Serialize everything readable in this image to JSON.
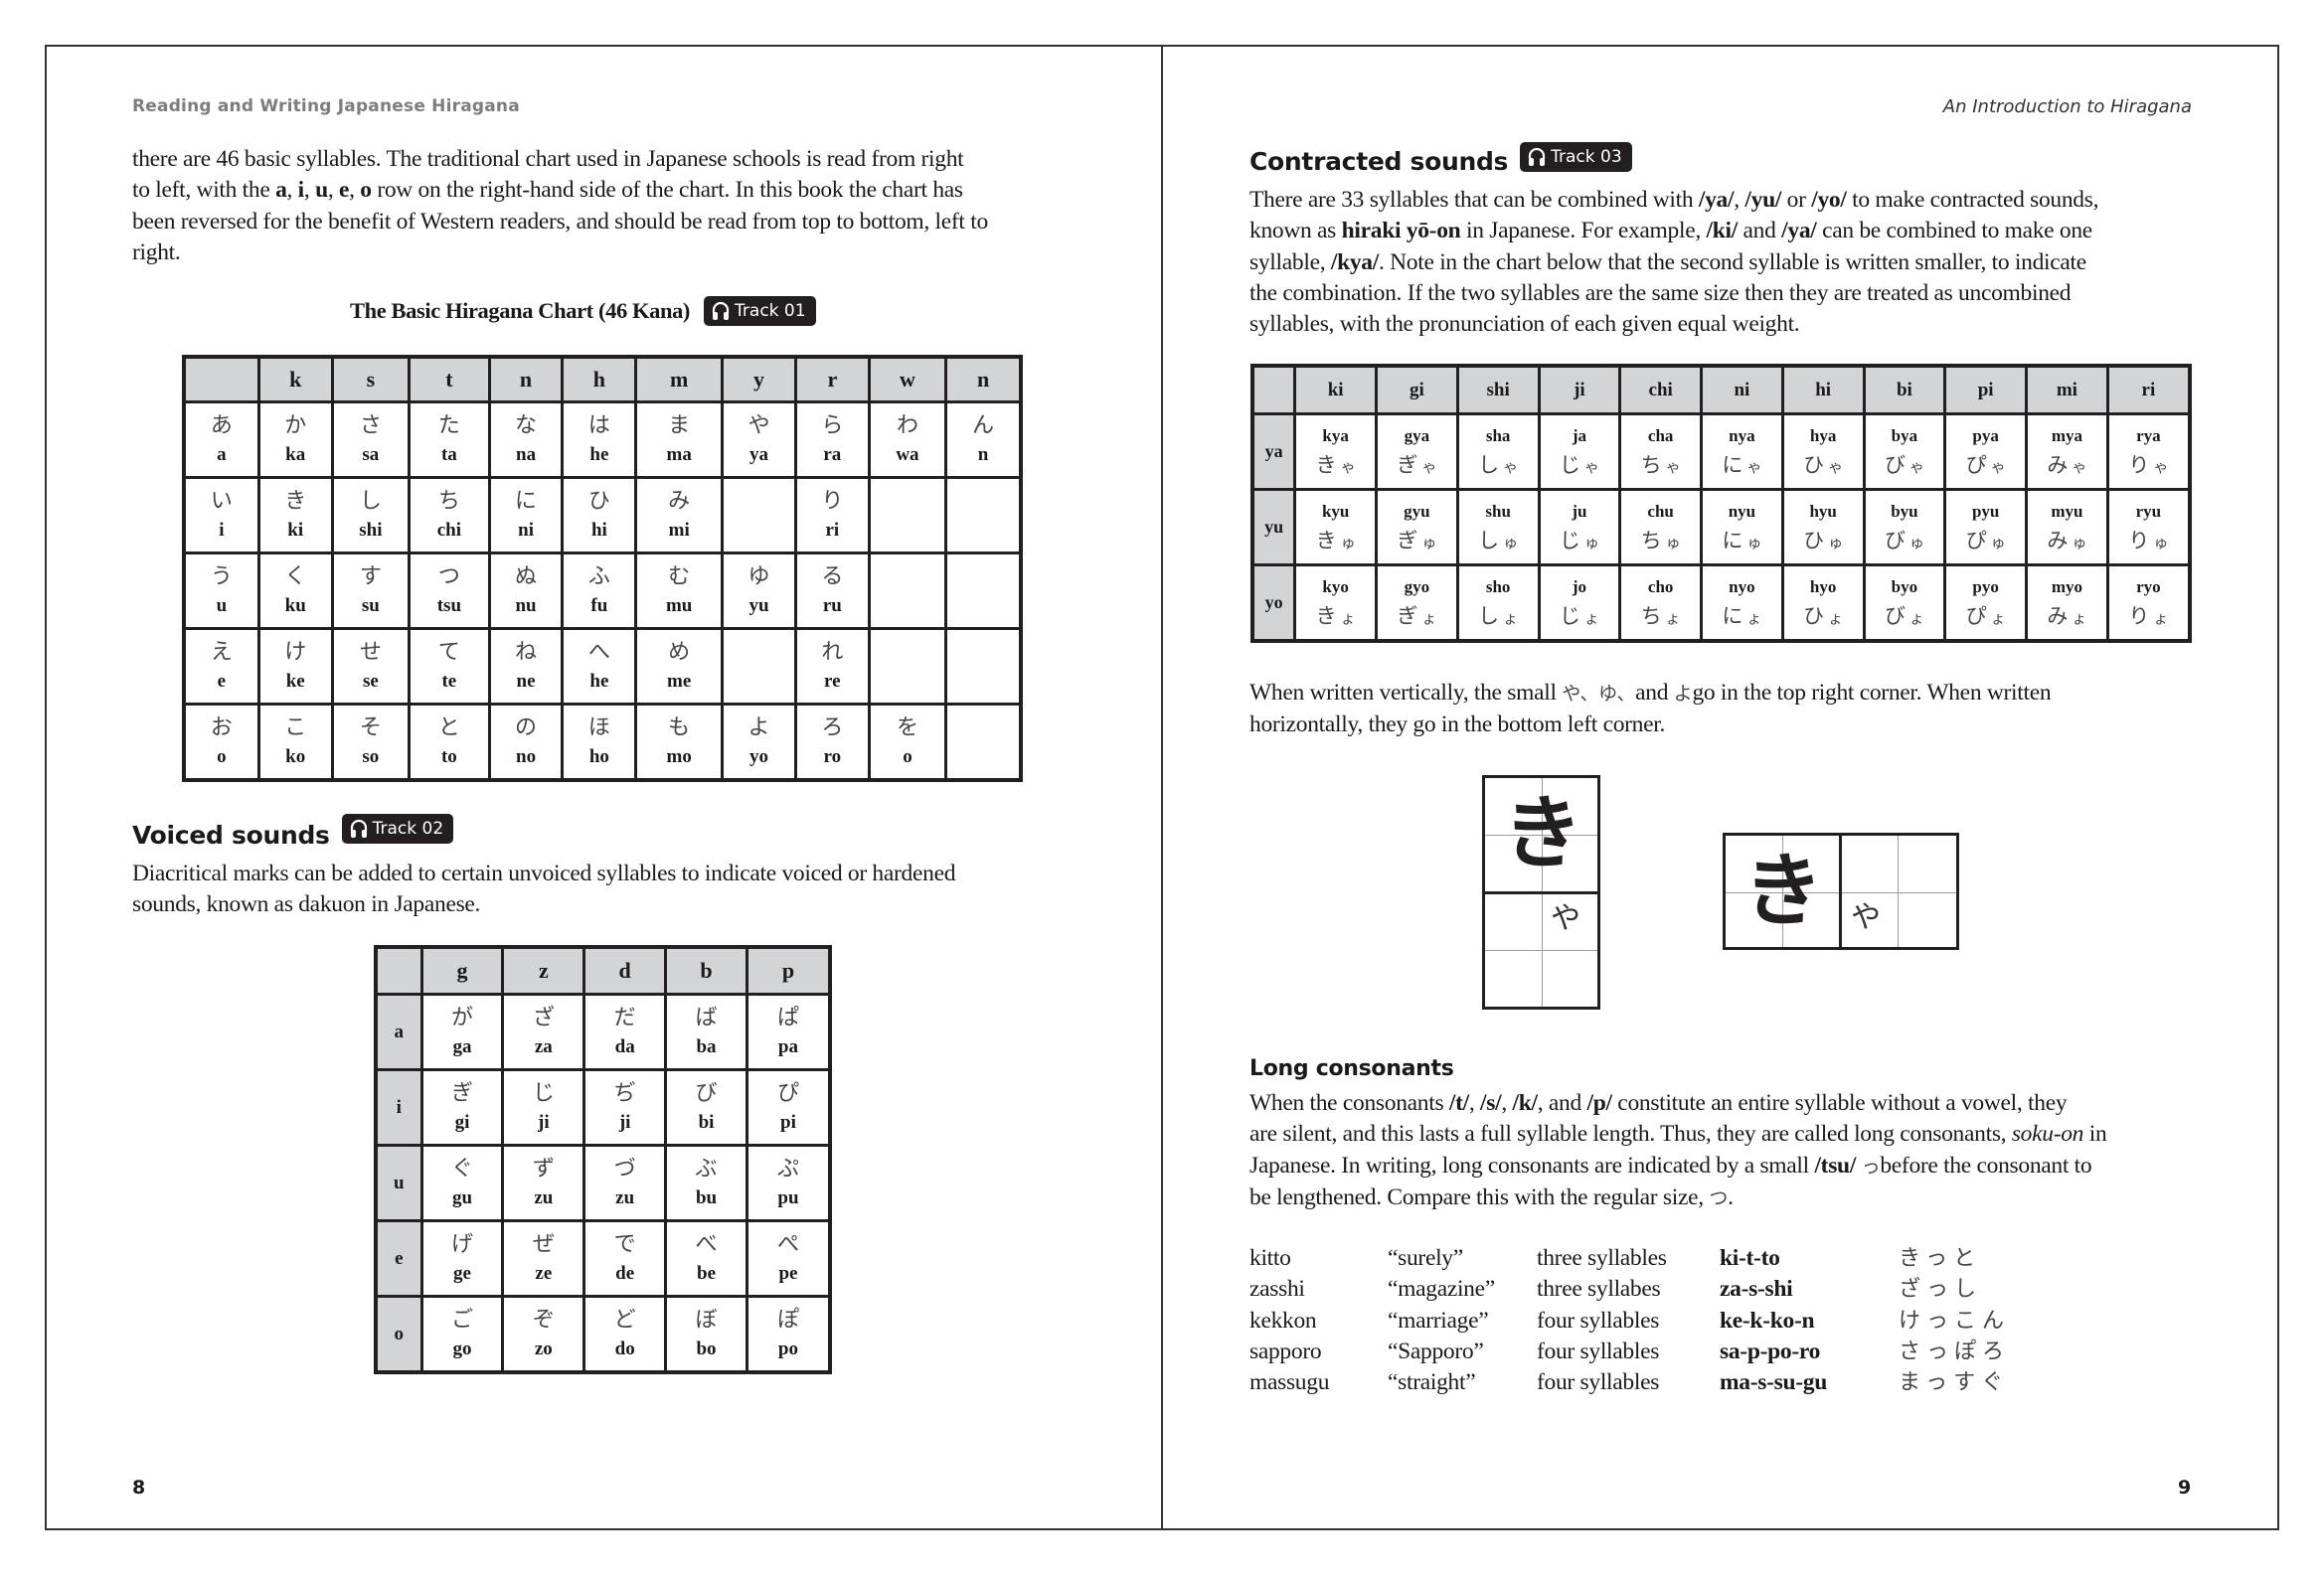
{
  "left_page": {
    "running_head": "Reading and Writing Japanese Hiragana",
    "intro_paragraph": [
      {
        "t": "there are 46 basic syllables. The traditional chart used in Japanese schools is read from right",
        "b": false
      },
      {
        "t": "to left, with the ",
        "b": false
      },
      {
        "t": "a",
        "b": true
      },
      {
        "t": ", ",
        "b": false
      },
      {
        "t": "i",
        "b": true
      },
      {
        "t": ", ",
        "b": false
      },
      {
        "t": "u",
        "b": true
      },
      {
        "t": ", ",
        "b": false
      },
      {
        "t": "e",
        "b": true
      },
      {
        "t": ", ",
        "b": false
      },
      {
        "t": "o",
        "b": true
      },
      {
        "t": " row on the right-hand side of the chart. In this book the chart has",
        "b": false
      },
      {
        "t": "been reversed for the benefit of Western readers, and should be read from top to bottom, left to",
        "b": false
      },
      {
        "t": "right.",
        "b": false
      }
    ],
    "intro_lines": [
      "there are 46 basic syllables. The traditional chart used in Japanese schools is read from right",
      "to left, with the |a|, |i|, |u|, |e|, |o| row on the right-hand side of the chart. In this book the chart has",
      "been reversed for the benefit of Western readers, and should be read from top to bottom, left to",
      "right."
    ],
    "basic_chart": {
      "title": "The Basic Hiragana Chart (46 Kana)",
      "track_label": "Track 01",
      "columns": [
        "",
        "k",
        "s",
        "t",
        "n",
        "h",
        "m",
        "y",
        "r",
        "w",
        "n"
      ],
      "rows": [
        [
          [
            "あ",
            "a"
          ],
          [
            "か",
            "ka"
          ],
          [
            "さ",
            "sa"
          ],
          [
            "た",
            "ta"
          ],
          [
            "な",
            "na"
          ],
          [
            "は",
            "he"
          ],
          [
            "ま",
            "ma"
          ],
          [
            "や",
            "ya"
          ],
          [
            "ら",
            "ra"
          ],
          [
            "わ",
            "wa"
          ],
          [
            "ん",
            "n"
          ]
        ],
        [
          [
            "い",
            "i"
          ],
          [
            "き",
            "ki"
          ],
          [
            "し",
            "shi"
          ],
          [
            "ち",
            "chi"
          ],
          [
            "に",
            "ni"
          ],
          [
            "ひ",
            "hi"
          ],
          [
            "み",
            "mi"
          ],
          [
            "",
            ""
          ],
          [
            "り",
            "ri"
          ],
          [
            "",
            ""
          ],
          [
            "",
            ""
          ]
        ],
        [
          [
            "う",
            "u"
          ],
          [
            "く",
            "ku"
          ],
          [
            "す",
            "su"
          ],
          [
            "つ",
            "tsu"
          ],
          [
            "ぬ",
            "nu"
          ],
          [
            "ふ",
            "fu"
          ],
          [
            "む",
            "mu"
          ],
          [
            "ゆ",
            "yu"
          ],
          [
            "る",
            "ru"
          ],
          [
            "",
            ""
          ],
          [
            "",
            ""
          ]
        ],
        [
          [
            "え",
            "e"
          ],
          [
            "け",
            "ke"
          ],
          [
            "せ",
            "se"
          ],
          [
            "て",
            "te"
          ],
          [
            "ね",
            "ne"
          ],
          [
            "へ",
            "he"
          ],
          [
            "め",
            "me"
          ],
          [
            "",
            ""
          ],
          [
            "れ",
            "re"
          ],
          [
            "",
            ""
          ],
          [
            "",
            ""
          ]
        ],
        [
          [
            "お",
            "o"
          ],
          [
            "こ",
            "ko"
          ],
          [
            "そ",
            "so"
          ],
          [
            "と",
            "to"
          ],
          [
            "の",
            "no"
          ],
          [
            "ほ",
            "ho"
          ],
          [
            "も",
            "mo"
          ],
          [
            "よ",
            "yo"
          ],
          [
            "ろ",
            "ro"
          ],
          [
            "を",
            "o"
          ],
          [
            "",
            ""
          ]
        ]
      ]
    },
    "voiced": {
      "heading": "Voiced sounds",
      "track_label": "Track 02",
      "lines": [
        "Diacritical marks can be added to certain unvoiced syllables to indicate voiced or hardened",
        "sounds, known as dakuon in Japanese."
      ],
      "columns": [
        "",
        "g",
        "z",
        "d",
        "b",
        "p"
      ],
      "row_heads": [
        "a",
        "i",
        "u",
        "e",
        "o"
      ],
      "rows": [
        [
          [
            "が",
            "ga"
          ],
          [
            "ざ",
            "za"
          ],
          [
            "だ",
            "da"
          ],
          [
            "ば",
            "ba"
          ],
          [
            "ぱ",
            "pa"
          ]
        ],
        [
          [
            "ぎ",
            "gi"
          ],
          [
            "じ",
            "ji"
          ],
          [
            "ぢ",
            "ji"
          ],
          [
            "び",
            "bi"
          ],
          [
            "ぴ",
            "pi"
          ]
        ],
        [
          [
            "ぐ",
            "gu"
          ],
          [
            "ず",
            "zu"
          ],
          [
            "づ",
            "zu"
          ],
          [
            "ぶ",
            "bu"
          ],
          [
            "ぷ",
            "pu"
          ]
        ],
        [
          [
            "げ",
            "ge"
          ],
          [
            "ぜ",
            "ze"
          ],
          [
            "で",
            "de"
          ],
          [
            "べ",
            "be"
          ],
          [
            "ぺ",
            "pe"
          ]
        ],
        [
          [
            "ご",
            "go"
          ],
          [
            "ぞ",
            "zo"
          ],
          [
            "ど",
            "do"
          ],
          [
            "ぼ",
            "bo"
          ],
          [
            "ぽ",
            "po"
          ]
        ]
      ]
    },
    "page_number": "8"
  },
  "right_page": {
    "running_head": "An Introduction to Hiragana",
    "contracted": {
      "heading": "Contracted sounds",
      "track_label": "Track 03",
      "lines": [
        "There are 33 syllables that can be combined with |/ya/|, |/yu/| or |/yo/| to make contracted sounds,",
        "known as |hiraki yō-on| in Japanese. For example, |/ki/| and |/ya/| can be combined to make one",
        "syllable, |/kya/|. Note in the chart below that the second syllable is written smaller, to indicate",
        "the combination. If the two syllables are the same size then they are treated as uncombined",
        "syllables, with the pronunciation of each given equal weight."
      ],
      "columns": [
        "",
        "ki",
        "gi",
        "shi",
        "ji",
        "chi",
        "ni",
        "hi",
        "bi",
        "pi",
        "mi",
        "ri"
      ],
      "row_heads": [
        "ya",
        "yu",
        "yo"
      ],
      "rows": [
        [
          [
            "kya",
            "きゃ"
          ],
          [
            "gya",
            "ぎゃ"
          ],
          [
            "sha",
            "しゃ"
          ],
          [
            "ja",
            "じゃ"
          ],
          [
            "cha",
            "ちゃ"
          ],
          [
            "nya",
            "にゃ"
          ],
          [
            "hya",
            "ひゃ"
          ],
          [
            "bya",
            "びゃ"
          ],
          [
            "pya",
            "ぴゃ"
          ],
          [
            "mya",
            "みゃ"
          ],
          [
            "rya",
            "りゃ"
          ]
        ],
        [
          [
            "kyu",
            "きゅ"
          ],
          [
            "gyu",
            "ぎゅ"
          ],
          [
            "shu",
            "しゅ"
          ],
          [
            "ju",
            "じゅ"
          ],
          [
            "chu",
            "ちゅ"
          ],
          [
            "nyu",
            "にゅ"
          ],
          [
            "hyu",
            "ひゅ"
          ],
          [
            "byu",
            "びゅ"
          ],
          [
            "pyu",
            "ぴゅ"
          ],
          [
            "myu",
            "みゅ"
          ],
          [
            "ryu",
            "りゅ"
          ]
        ],
        [
          [
            "kyo",
            "きょ"
          ],
          [
            "gyo",
            "ぎょ"
          ],
          [
            "sho",
            "しょ"
          ],
          [
            "jo",
            "じょ"
          ],
          [
            "cho",
            "ちょ"
          ],
          [
            "nyo",
            "にょ"
          ],
          [
            "hyo",
            "ひょ"
          ],
          [
            "byo",
            "びょ"
          ],
          [
            "pyo",
            "ぴょ"
          ],
          [
            "myo",
            "みょ"
          ],
          [
            "ryo",
            "りょ"
          ]
        ]
      ]
    },
    "placement": {
      "lines": [
        "When written vertically, the small |~や、ゆ、|and |~よ|go in the top right corner. When written",
        "horizontally, they go in the bottom left corner."
      ],
      "diagram_big_kana": "き",
      "diagram_small_kana": "や"
    },
    "long_consonants": {
      "heading": "Long consonants",
      "lines": [
        "When the consonants |/t/|, |/s/|, |/k/|, and |/p/| constitute an entire syllable without a vowel, they",
        "are silent, and this lasts a full syllable length. Thus, they are called long consonants, _soku-on_ in",
        "Japanese. In writing, long consonants are indicated by a small |/tsu/| ~っ|before the consonant to",
        "be lengthened. Compare this with the regular size, ~つ|."
      ],
      "examples": [
        {
          "word": "kitto",
          "meaning": "“surely”",
          "count": "three syllables",
          "split": "ki-t-to",
          "kana": "きっと"
        },
        {
          "word": "zasshi",
          "meaning": "“magazine”",
          "count": "three syllabes",
          "split": "za-s-shi",
          "kana": "ざっし"
        },
        {
          "word": "kekkon",
          "meaning": "“marriage”",
          "count": "four syllables",
          "split": "ke-k-ko-n",
          "kana": "けっこん"
        },
        {
          "word": "sapporo",
          "meaning": "“Sapporo”",
          "count": "four syllables",
          "split": "sa-p-po-ro",
          "kana": "さっぽろ"
        },
        {
          "word": "massugu",
          "meaning": "“straight”",
          "count": "four syllables",
          "split": "ma-s-su-gu",
          "kana": "まっすぐ"
        }
      ]
    },
    "page_number": "9"
  },
  "icons": {
    "track_badge": "headphones-icon"
  },
  "colors": {
    "header_fill": "#d3d4d6",
    "badge_bg": "#231f20",
    "rule": "#231f20",
    "running_head_gray": "#7d7d7d"
  }
}
